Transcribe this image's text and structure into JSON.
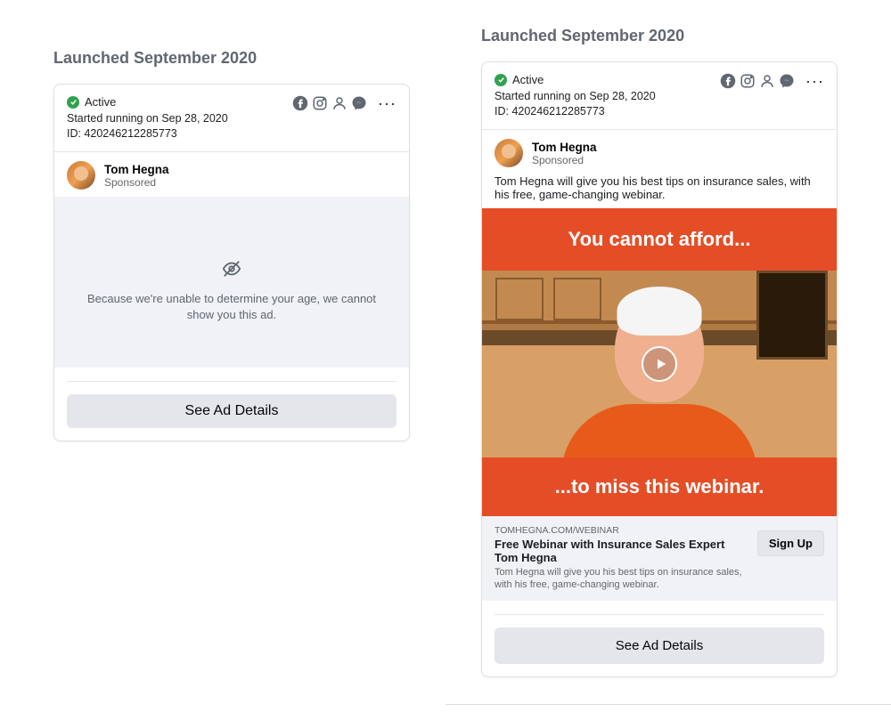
{
  "left": {
    "launched_label": "Launched September 2020",
    "status": "Active",
    "started": "Started running on Sep 28, 2020",
    "id_line": "ID: 420246212285773",
    "advertiser_name": "Tom Hegna",
    "sponsored_label": "Sponsored",
    "hidden_message": "Because we're unable to determine your age, we cannot show you this ad.",
    "details_button": "See Ad Details"
  },
  "right": {
    "launched_label": "Launched September 2020",
    "status": "Active",
    "started": "Started running on Sep 28, 2020",
    "id_line": "ID: 420246212285773",
    "advertiser_name": "Tom Hegna",
    "sponsored_label": "Sponsored",
    "ad_text": "Tom Hegna will give you his best tips on insurance sales, with his free, game-changing webinar.",
    "banner_top": "You cannot afford...",
    "banner_bottom": "...to miss this webinar.",
    "link_domain": "TOMHEGNA.COM/WEBINAR",
    "link_title": "Free Webinar with Insurance Sales Expert Tom Hegna",
    "link_desc": "Tom Hegna will give you his best tips on insurance sales, with his free, game-changing webinar.",
    "cta": "Sign Up",
    "details_button": "See Ad Details"
  }
}
